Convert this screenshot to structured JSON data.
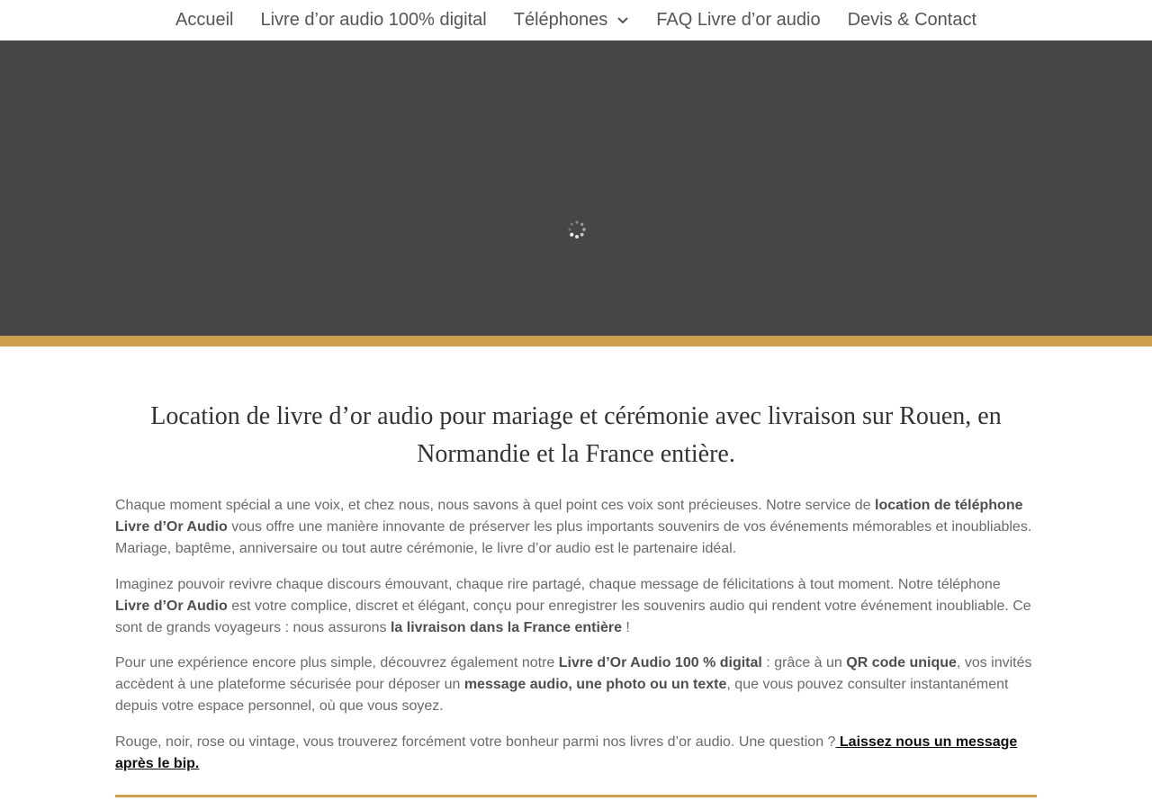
{
  "nav": {
    "items": [
      {
        "label": "Accueil"
      },
      {
        "label": "Livre d’or audio 100% digital"
      },
      {
        "label": "Téléphones"
      },
      {
        "label": "FAQ Livre d’or audio"
      },
      {
        "label": "Devis & Contact"
      }
    ]
  },
  "colors": {
    "hero_bg": "#464646",
    "accent_gold": "#cc9f4f",
    "text": "#6a6a6a"
  },
  "main": {
    "title": "Location de livre d’or audio pour mariage et cérémonie avec livraison sur Rouen, en Normandie et la France entière.",
    "p1": {
      "a": "Chaque moment spécial a une voix, et chez nous, nous savons à quel point ces voix sont précieuses. Notre service de ",
      "b": "location de téléphone Livre d’Or Audio",
      "c": " vous offre une manière innovante de préserver les plus importants souvenirs de vos événements mémorables et inoubliables. Mariage, baptême, anniversaire ou tout autre cérémonie, le livre d’or audio est le partenaire idéal."
    },
    "p2": {
      "a": "Imaginez pouvoir revivre chaque discours émouvant, chaque rire partagé, chaque message de félicitations à tout moment. Notre téléphone ",
      "b": "Livre d’Or Audio",
      "c": " est votre complice, discret et élégant, conçu pour enregistrer les souvenirs audio qui rendent votre événement inoubliable. Ce sont de grands voyageurs : nous assurons ",
      "d": "la livraison dans la France entière",
      "e": " !"
    },
    "p3": {
      "a": "Pour une expérience encore plus simple, découvrez également notre ",
      "b": "Livre d’Or Audio 100 % digital",
      "c": " : grâce à un ",
      "d": "QR code unique",
      "e": ", vos invités accèdent à une plateforme sécurisée pour déposer un ",
      "f": "message audio, une photo ou un texte",
      "g": ", que vous pouvez consulter instantanément depuis votre espace personnel, où que vous soyez."
    },
    "p4": {
      "a": "Rouge, noir, rose ou vintage, vous trouverez forcément votre bonheur parmi nos livres d’or audio. Une question ?",
      "link": " Laissez nous un message après le bip."
    }
  }
}
